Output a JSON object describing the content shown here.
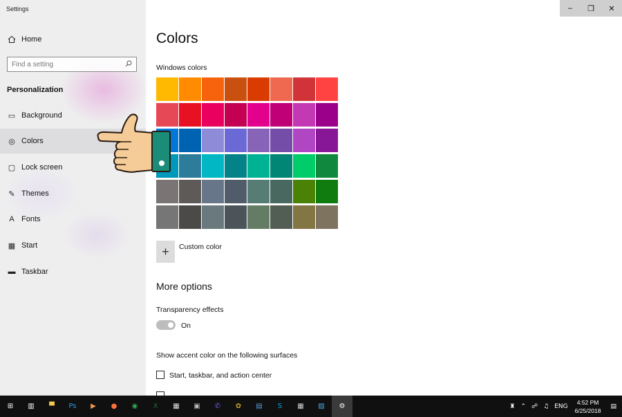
{
  "window": {
    "title": "Settings",
    "controls": {
      "minimize": "–",
      "maximize": "❐",
      "close": "✕"
    }
  },
  "sidebar": {
    "home_label": "Home",
    "search_placeholder": "Find a setting",
    "section_title": "Personalization",
    "items": [
      {
        "label": "Background",
        "icon": "image-icon",
        "glyph": "▭"
      },
      {
        "label": "Colors",
        "icon": "palette-icon",
        "glyph": "◎"
      },
      {
        "label": "Lock screen",
        "icon": "lock-screen-icon",
        "glyph": "▢"
      },
      {
        "label": "Themes",
        "icon": "themes-icon",
        "glyph": "✎"
      },
      {
        "label": "Fonts",
        "icon": "fonts-icon",
        "glyph": "A"
      },
      {
        "label": "Start",
        "icon": "start-icon",
        "glyph": "▦"
      },
      {
        "label": "Taskbar",
        "icon": "taskbar-icon",
        "glyph": "▬"
      }
    ],
    "selected": "Colors"
  },
  "main": {
    "title": "Colors",
    "windows_colors_label": "Windows colors",
    "palette": [
      "#ffb900",
      "#ff8c00",
      "#f7630c",
      "#ca5010",
      "#da3b01",
      "#ef6950",
      "#d13438",
      "#ff4343",
      "#e74856",
      "#e81123",
      "#ea005e",
      "#c30052",
      "#e3008c",
      "#bf0077",
      "#c239b3",
      "#9a0089",
      "#0078d7",
      "#0063b1",
      "#8e8cd8",
      "#6b69d6",
      "#8764b8",
      "#744da9",
      "#b146c2",
      "#881798",
      "#0099bc",
      "#2d7d9a",
      "#00b7c3",
      "#038387",
      "#00b294",
      "#018574",
      "#00cc6a",
      "#10893e",
      "#7a7574",
      "#5d5a58",
      "#68768a",
      "#515c6b",
      "#567c73",
      "#486860",
      "#498205",
      "#107c10",
      "#767676",
      "#4c4a48",
      "#69797e",
      "#4a5459",
      "#647c64",
      "#525e54",
      "#847545",
      "#7e735f"
    ],
    "custom_color_label": "Custom color",
    "more_options_title": "More options",
    "transparency_label": "Transparency effects",
    "transparency_state": "On",
    "accent_surfaces_label": "Show accent color on the following surfaces",
    "checkbox_label": "Start, taskbar, and action center"
  },
  "taskbar": {
    "apps": [
      {
        "name": "start-icon",
        "glyph": "⊞",
        "color": "#ffffff"
      },
      {
        "name": "task-view-icon",
        "glyph": "▥",
        "color": "#ffffff"
      },
      {
        "name": "file-explorer-icon",
        "glyph": "▀",
        "color": "#f2c94c"
      },
      {
        "name": "photoshop-icon",
        "glyph": "Ps",
        "color": "#2d9cdb"
      },
      {
        "name": "media-player-icon",
        "glyph": "▶",
        "color": "#f2994a"
      },
      {
        "name": "firefox-icon",
        "glyph": "●",
        "color": "#ff7139"
      },
      {
        "name": "chrome-icon",
        "glyph": "◉",
        "color": "#34a853"
      },
      {
        "name": "excel-icon",
        "glyph": "X",
        "color": "#1d6f42"
      },
      {
        "name": "calendar-icon",
        "glyph": "▦",
        "color": "#e0e0e0"
      },
      {
        "name": "network-icon",
        "glyph": "▣",
        "color": "#bdbdbd"
      },
      {
        "name": "viber-icon",
        "glyph": "✆",
        "color": "#7360f2"
      },
      {
        "name": "tools-icon",
        "glyph": "✿",
        "color": "#c9a227"
      },
      {
        "name": "photos-icon",
        "glyph": "▤",
        "color": "#5b9bd5"
      },
      {
        "name": "skype-icon",
        "glyph": "S",
        "color": "#00aff0"
      },
      {
        "name": "calculator-icon",
        "glyph": "▦",
        "color": "#d0d0d0"
      },
      {
        "name": "remote-desktop-icon",
        "glyph": "▨",
        "color": "#4aa3df"
      },
      {
        "name": "settings-icon",
        "glyph": "⚙",
        "color": "#ffffff"
      }
    ],
    "language": "ENG",
    "time": "4:52 PM",
    "date": "6/25/2018"
  }
}
